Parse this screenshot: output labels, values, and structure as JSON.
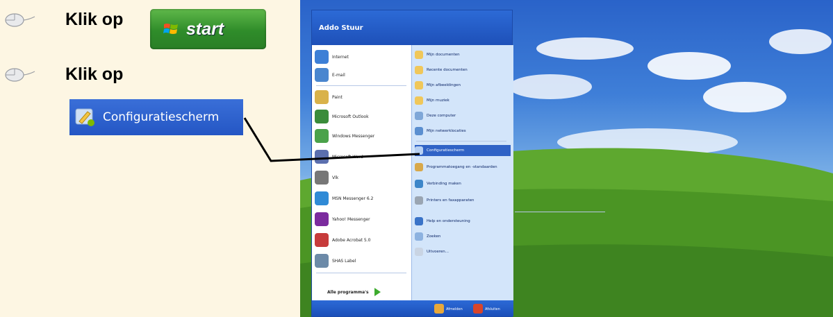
{
  "instructions": {
    "step1": "Klik op",
    "step2": "Klik op",
    "start_button": "start",
    "control_panel_button": "Configuratiescherm"
  },
  "start_menu": {
    "user": "Addo Stuur",
    "left_items": [
      "Internet",
      "E-mail",
      "Paint",
      "Microsoft Outlook",
      "Windows Messenger",
      "Microsoft Word",
      "Vlk",
      "MSN Messenger 6.2",
      "Yahoo! Messenger",
      "Adobe Acrobat 5.0",
      "SHAS Label"
    ],
    "all_programs": "Alle programma's",
    "right_items": [
      "Mijn documenten",
      "Recente documenten",
      "Mijn afbeeldingen",
      "Mijn muziek",
      "Deze computer",
      "Mijn netwerklocaties",
      "Configuratiescherm",
      "Programmatoegang en -standaarden",
      "Verbinding maken",
      "Printers en faxapparaten",
      "Help en ondersteuning",
      "Zoeken",
      "Uitvoeren..."
    ],
    "footer": {
      "logoff": "Afmelden",
      "shutdown": "Afsluiten"
    }
  },
  "colors": {
    "panel_bg": "#fdf6e3",
    "start_green": "#3a9a33",
    "xp_blue": "#2456c4"
  }
}
